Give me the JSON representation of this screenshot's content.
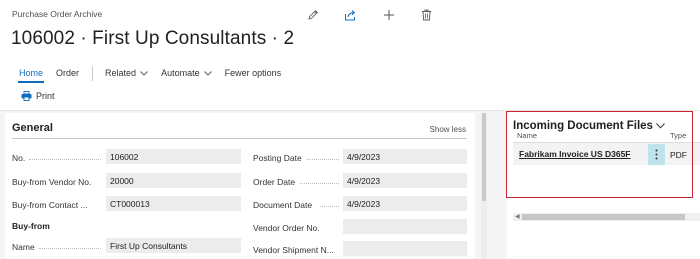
{
  "header": {
    "archive_label": "Purchase Order Archive",
    "title": "106002 · First Up Consultants · 2",
    "icons": [
      "pencil-icon",
      "share-icon",
      "plus-icon",
      "trash-icon"
    ]
  },
  "nav": {
    "items": [
      {
        "label": "Home",
        "active": true
      },
      {
        "label": "Order",
        "active": false
      },
      {
        "label": "Related",
        "active": false,
        "dropdown": true
      },
      {
        "label": "Automate",
        "active": false,
        "dropdown": true
      },
      {
        "label": "Fewer options",
        "active": false
      }
    ],
    "print_label": "Print"
  },
  "general": {
    "title": "General",
    "show_less": "Show less",
    "left_fields": [
      {
        "label": "No.",
        "value": "106002"
      },
      {
        "label": "Buy-from Vendor No.",
        "value": "20000"
      },
      {
        "label": "Buy-from Contact ...",
        "value": "CT000013"
      }
    ],
    "group_label": "Buy-from",
    "name_field": {
      "label": "Name",
      "value": "First Up Consultants"
    },
    "right_fields": [
      {
        "label": "Posting Date",
        "value": "4/9/2023"
      },
      {
        "label": "Order Date",
        "value": "4/9/2023"
      },
      {
        "label": "Document Date",
        "value": "4/9/2023"
      },
      {
        "label": "Vendor Order No.",
        "value": ""
      },
      {
        "label": "Vendor Shipment N...",
        "value": ""
      }
    ]
  },
  "incoming": {
    "title": "Incoming Document Files",
    "col_name": "Name",
    "col_type": "Type",
    "rows": [
      {
        "name": "Fabrikam Invoice US D365F",
        "type": "PDF"
      }
    ]
  },
  "colors": {
    "accent": "#0f6cbd",
    "highlight": "#c7252f",
    "row_menu": "#bfe3ea"
  }
}
